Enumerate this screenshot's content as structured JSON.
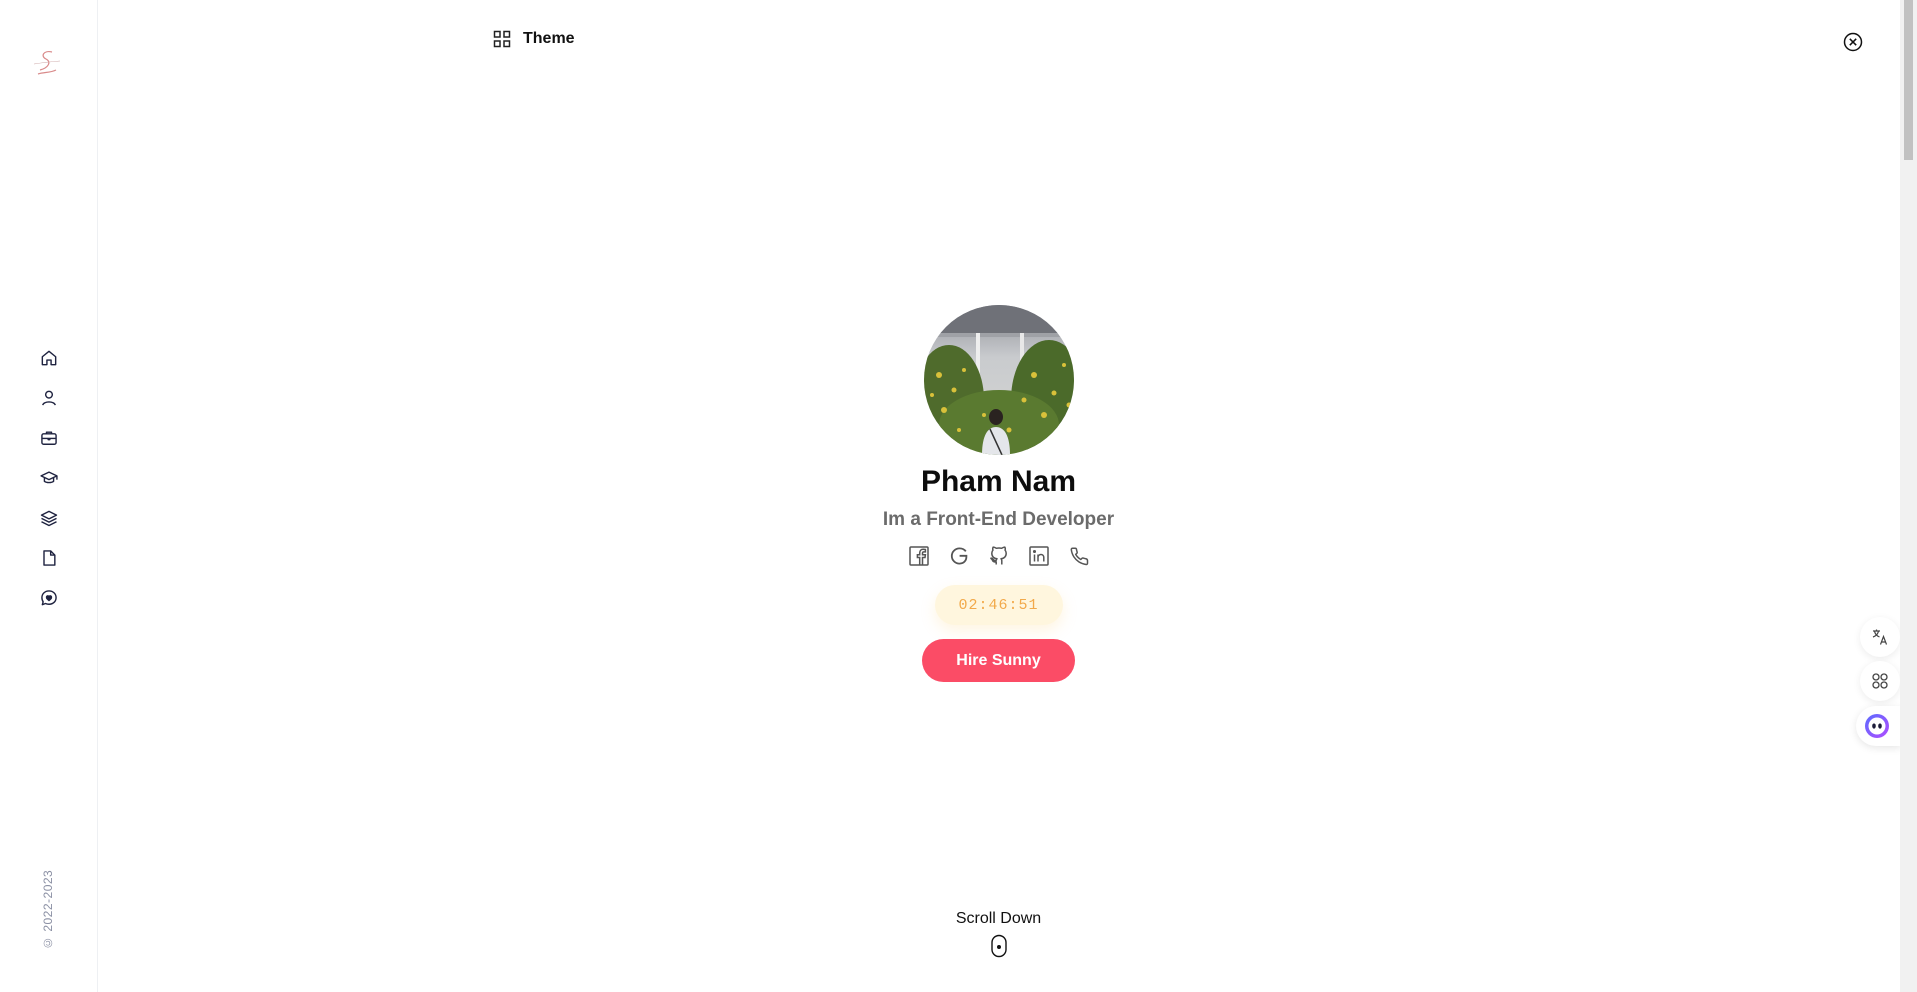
{
  "sidebar": {
    "nav_items": [
      {
        "name": "home-icon"
      },
      {
        "name": "user-icon"
      },
      {
        "name": "briefcase-icon"
      },
      {
        "name": "graduation-cap-icon"
      },
      {
        "name": "layers-icon"
      },
      {
        "name": "document-icon"
      },
      {
        "name": "chat-heart-icon"
      }
    ],
    "copyright": "© 2022-2023"
  },
  "header": {
    "theme_label": "Theme"
  },
  "hero": {
    "name": "Pham Nam",
    "role": "Im a Front-End Developer",
    "socials": [
      "facebook-icon",
      "google-icon",
      "github-icon",
      "linkedin-icon",
      "phone-icon"
    ],
    "clock": "02:46:51",
    "hire_label": "Hire Sunny"
  },
  "scroll": {
    "label": "Scroll Down"
  },
  "colors": {
    "accent": "#fb4c66",
    "clock_bg": "#fff6de",
    "clock_text": "#f2a94a",
    "nav_icon": "#1f2340"
  }
}
